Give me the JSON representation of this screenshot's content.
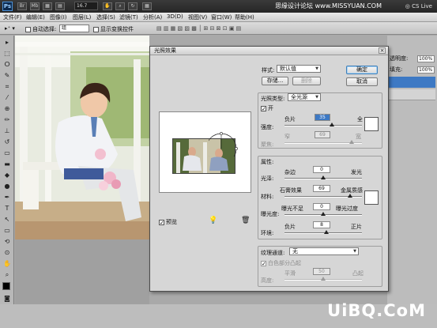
{
  "appbar": {
    "logo": "Ps",
    "icons": [
      "Br",
      "Mb",
      "▦",
      "▤"
    ],
    "zoom": "16.7",
    "arrange": "▾",
    "watermark": "思缘设计论坛 www.MISSYUAN.COM",
    "cslive": "CS Live"
  },
  "menubar": {
    "items": [
      "文件(F)",
      "编辑(E)",
      "图像(I)",
      "图层(L)",
      "选择(S)",
      "滤镜(T)",
      "分析(A)",
      "3D(D)",
      "视图(V)",
      "窗口(W)",
      "帮助(H)"
    ]
  },
  "options": {
    "auto_select": "自动选择:",
    "auto_select_value": "组",
    "show_transform": "显示变换控件"
  },
  "panels": {
    "opacity_label": "透明度:",
    "opacity_value": "100%",
    "fill_label": "填充:",
    "fill_value": "100%"
  },
  "dialog": {
    "title": "光照效果",
    "style_label": "样式:",
    "style_value": "默认值",
    "save_button": "存储...",
    "delete_button": "删除",
    "ok_button": "确定",
    "cancel_button": "取消",
    "light_type_label": "光照类型:",
    "light_type_value": "全光源",
    "on_label": "开",
    "intensity_label": "强度:",
    "intensity_min": "负片",
    "intensity_max": "全",
    "intensity_value": "35",
    "focus_label": "聚焦:",
    "focus_min": "窄",
    "focus_max": "宽",
    "focus_value": "69",
    "properties_label": "属性:",
    "gloss_label": "光泽:",
    "gloss_min": "杂边",
    "gloss_max": "发光",
    "gloss_value": "0",
    "material_label": "材料:",
    "material_min": "石膏效果",
    "material_max": "金属质感",
    "material_value": "69",
    "exposure_label": "曝光度:",
    "exposure_min": "曝光不足",
    "exposure_max": "曝光过度",
    "exposure_value": "0",
    "ambience_label": "环境:",
    "ambience_min": "负片",
    "ambience_max": "正片",
    "ambience_value": "8",
    "texture_label": "纹理通道:",
    "texture_value": "无",
    "white_high_label": "白色部分凸起",
    "height_label": "高度:",
    "height_min": "平滑",
    "height_max": "凸起",
    "height_value": "50",
    "preview_label": "预览"
  },
  "watermark_bottom": "UiBQ.CoM",
  "colors": {
    "accent": "#3f7fb8",
    "dialog_bg": "#d6d6d6",
    "app_dark": "#262626"
  }
}
